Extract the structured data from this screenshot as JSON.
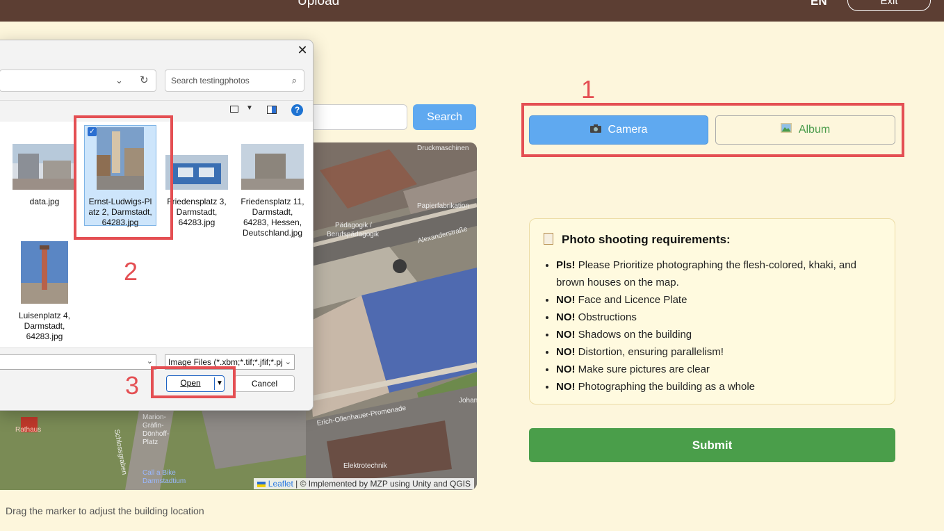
{
  "header": {
    "title": "Upload",
    "language": "EN",
    "exit_label": "Exit"
  },
  "search": {
    "button_label": "Search"
  },
  "map": {
    "labels": [
      "Druckmaschinen",
      "Papierfabrikation",
      "Pädagogik /",
      "Berufspädagogik",
      "Alexanderstraße",
      "Marion-Gräfin-Dönhoff-Platz",
      "Schlossgraben",
      "Call a Bike Darmstadtium",
      "Erich-Ollenhauer-Promenade",
      "Elektrotechnik",
      "Johan",
      "Rathaus"
    ],
    "attribution_link": "Leaflet",
    "attribution_text": "| © Implemented by MZP using Unity and QGIS",
    "hint": "Drag the marker to adjust the building location"
  },
  "file_dialog": {
    "search_placeholder": "Search testingphotos",
    "files": [
      {
        "name": "data.jpg",
        "selected": false
      },
      {
        "name": "Ernst-Ludwigs-Platz 2, Darmstadt, 64283.jpg",
        "lines": [
          "Ernst-Ludwigs-Pl",
          "atz 2, Darmstadt,",
          "64283.jpg"
        ],
        "selected": true
      },
      {
        "name": "Friedensplatz 3, Darmstadt, 64283.jpg",
        "lines": [
          "Friedensplatz 3,",
          "Darmstadt,",
          "64283.jpg"
        ],
        "selected": false
      },
      {
        "name": "Friedensplatz 11, Darmstadt, 64283, Hessen, Deutschland.jpg",
        "lines": [
          "Friedensplatz 11,",
          "Darmstadt,",
          "64283, Hessen,",
          "Deutschland.jpg"
        ],
        "selected": false
      },
      {
        "name": "Luisenplatz 4, Darmstadt, 64283.jpg",
        "lines": [
          "Luisenplatz 4,",
          "Darmstadt,",
          "64283.jpg"
        ],
        "selected": false
      }
    ],
    "file_type": "Image Files (*.xbm;*.tif;*.jfif;*.pj",
    "open_label": "Open",
    "cancel_label": "Cancel"
  },
  "annotations": {
    "step1": "1",
    "step2": "2",
    "step3": "3",
    "color": "#e44f53"
  },
  "capture": {
    "camera_label": "Camera",
    "album_label": "Album"
  },
  "requirements": {
    "title": "Photo shooting requirements:",
    "items": [
      {
        "prefix": "Pls!",
        "text": "Please Prioritize photographing the flesh-colored, khaki, and brown houses on the map."
      },
      {
        "prefix": "NO!",
        "text": "Face and Licence Plate"
      },
      {
        "prefix": "NO!",
        "text": "Obstructions"
      },
      {
        "prefix": "NO!",
        "text": "Shadows on the building"
      },
      {
        "prefix": "NO!",
        "text": "Distortion, ensuring parallelism!"
      },
      {
        "prefix": "NO!",
        "text": "Make sure pictures are clear"
      },
      {
        "prefix": "NO!",
        "text": "Photographing the building as a whole"
      }
    ]
  },
  "submit_label": "Submit",
  "colors": {
    "header": "#5c3e33",
    "background": "#fdf6dc",
    "primary_blue": "#5fa9f0",
    "submit_green": "#4a9e4a",
    "album_green": "#4a9b4a"
  }
}
